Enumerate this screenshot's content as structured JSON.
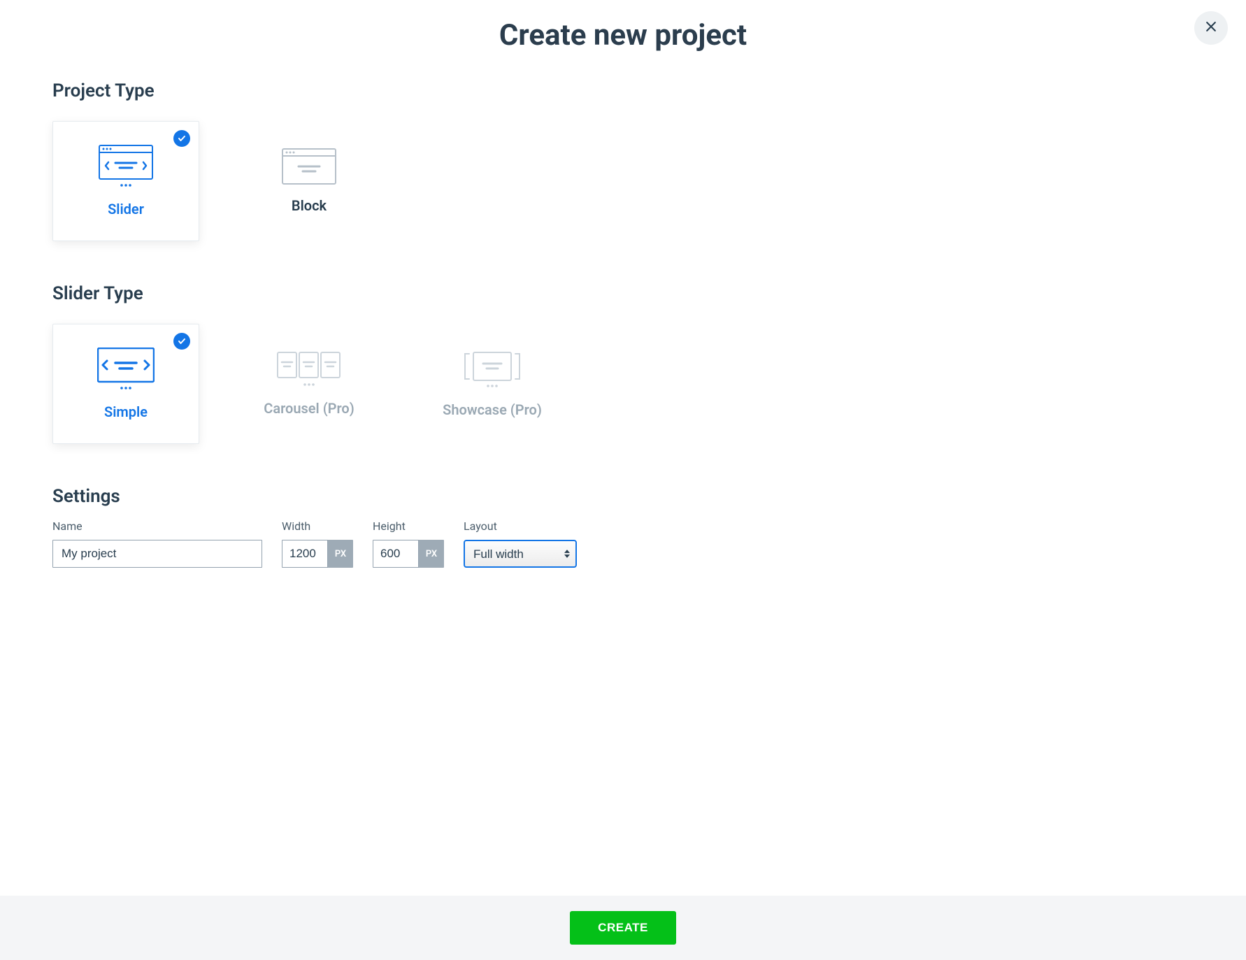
{
  "modal": {
    "title": "Create new project"
  },
  "sections": {
    "projectType": {
      "heading": "Project Type",
      "options": {
        "slider": "Slider",
        "block": "Block"
      }
    },
    "sliderType": {
      "heading": "Slider Type",
      "options": {
        "simple": "Simple",
        "carousel": "Carousel (Pro)",
        "showcase": "Showcase (Pro)"
      }
    },
    "settings": {
      "heading": "Settings",
      "name": {
        "label": "Name",
        "value": "My project"
      },
      "width": {
        "label": "Width",
        "value": "1200",
        "unit": "PX"
      },
      "height": {
        "label": "Height",
        "value": "600",
        "unit": "PX"
      },
      "layout": {
        "label": "Layout",
        "value": "Full width"
      }
    }
  },
  "actions": {
    "create": "CREATE"
  }
}
